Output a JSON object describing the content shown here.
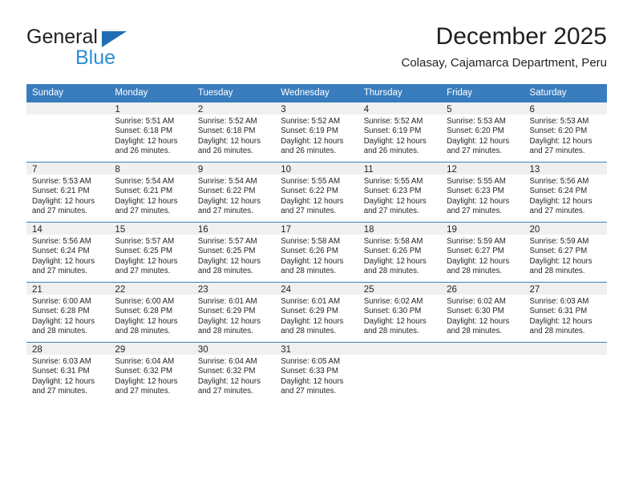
{
  "brand": {
    "name_top": "General",
    "name_bottom": "Blue",
    "triangle_color": "#1f6eb5",
    "blue_color": "#2a8fd4"
  },
  "header": {
    "title": "December 2025",
    "subtitle": "Colasay, Cajamarca Department, Peru"
  },
  "theme": {
    "header_bg": "#3a7dbe",
    "daynum_bg": "#f0f0f0",
    "text": "#231f20"
  },
  "weekdays": [
    "Sunday",
    "Monday",
    "Tuesday",
    "Wednesday",
    "Thursday",
    "Friday",
    "Saturday"
  ],
  "labels": {
    "sunrise_prefix": "Sunrise: ",
    "sunset_prefix": "Sunset: ",
    "daylight_prefix": "Daylight: "
  },
  "weeks": [
    [
      {
        "day": "",
        "empty": true
      },
      {
        "day": "1",
        "sunrise": "Sunrise: 5:51 AM",
        "sunset": "Sunset: 6:18 PM",
        "daylight_line1": "Daylight: 12 hours",
        "daylight_line2": "and 26 minutes."
      },
      {
        "day": "2",
        "sunrise": "Sunrise: 5:52 AM",
        "sunset": "Sunset: 6:18 PM",
        "daylight_line1": "Daylight: 12 hours",
        "daylight_line2": "and 26 minutes."
      },
      {
        "day": "3",
        "sunrise": "Sunrise: 5:52 AM",
        "sunset": "Sunset: 6:19 PM",
        "daylight_line1": "Daylight: 12 hours",
        "daylight_line2": "and 26 minutes."
      },
      {
        "day": "4",
        "sunrise": "Sunrise: 5:52 AM",
        "sunset": "Sunset: 6:19 PM",
        "daylight_line1": "Daylight: 12 hours",
        "daylight_line2": "and 26 minutes."
      },
      {
        "day": "5",
        "sunrise": "Sunrise: 5:53 AM",
        "sunset": "Sunset: 6:20 PM",
        "daylight_line1": "Daylight: 12 hours",
        "daylight_line2": "and 27 minutes."
      },
      {
        "day": "6",
        "sunrise": "Sunrise: 5:53 AM",
        "sunset": "Sunset: 6:20 PM",
        "daylight_line1": "Daylight: 12 hours",
        "daylight_line2": "and 27 minutes."
      }
    ],
    [
      {
        "day": "7",
        "sunrise": "Sunrise: 5:53 AM",
        "sunset": "Sunset: 6:21 PM",
        "daylight_line1": "Daylight: 12 hours",
        "daylight_line2": "and 27 minutes."
      },
      {
        "day": "8",
        "sunrise": "Sunrise: 5:54 AM",
        "sunset": "Sunset: 6:21 PM",
        "daylight_line1": "Daylight: 12 hours",
        "daylight_line2": "and 27 minutes."
      },
      {
        "day": "9",
        "sunrise": "Sunrise: 5:54 AM",
        "sunset": "Sunset: 6:22 PM",
        "daylight_line1": "Daylight: 12 hours",
        "daylight_line2": "and 27 minutes."
      },
      {
        "day": "10",
        "sunrise": "Sunrise: 5:55 AM",
        "sunset": "Sunset: 6:22 PM",
        "daylight_line1": "Daylight: 12 hours",
        "daylight_line2": "and 27 minutes."
      },
      {
        "day": "11",
        "sunrise": "Sunrise: 5:55 AM",
        "sunset": "Sunset: 6:23 PM",
        "daylight_line1": "Daylight: 12 hours",
        "daylight_line2": "and 27 minutes."
      },
      {
        "day": "12",
        "sunrise": "Sunrise: 5:55 AM",
        "sunset": "Sunset: 6:23 PM",
        "daylight_line1": "Daylight: 12 hours",
        "daylight_line2": "and 27 minutes."
      },
      {
        "day": "13",
        "sunrise": "Sunrise: 5:56 AM",
        "sunset": "Sunset: 6:24 PM",
        "daylight_line1": "Daylight: 12 hours",
        "daylight_line2": "and 27 minutes."
      }
    ],
    [
      {
        "day": "14",
        "sunrise": "Sunrise: 5:56 AM",
        "sunset": "Sunset: 6:24 PM",
        "daylight_line1": "Daylight: 12 hours",
        "daylight_line2": "and 27 minutes."
      },
      {
        "day": "15",
        "sunrise": "Sunrise: 5:57 AM",
        "sunset": "Sunset: 6:25 PM",
        "daylight_line1": "Daylight: 12 hours",
        "daylight_line2": "and 27 minutes."
      },
      {
        "day": "16",
        "sunrise": "Sunrise: 5:57 AM",
        "sunset": "Sunset: 6:25 PM",
        "daylight_line1": "Daylight: 12 hours",
        "daylight_line2": "and 28 minutes."
      },
      {
        "day": "17",
        "sunrise": "Sunrise: 5:58 AM",
        "sunset": "Sunset: 6:26 PM",
        "daylight_line1": "Daylight: 12 hours",
        "daylight_line2": "and 28 minutes."
      },
      {
        "day": "18",
        "sunrise": "Sunrise: 5:58 AM",
        "sunset": "Sunset: 6:26 PM",
        "daylight_line1": "Daylight: 12 hours",
        "daylight_line2": "and 28 minutes."
      },
      {
        "day": "19",
        "sunrise": "Sunrise: 5:59 AM",
        "sunset": "Sunset: 6:27 PM",
        "daylight_line1": "Daylight: 12 hours",
        "daylight_line2": "and 28 minutes."
      },
      {
        "day": "20",
        "sunrise": "Sunrise: 5:59 AM",
        "sunset": "Sunset: 6:27 PM",
        "daylight_line1": "Daylight: 12 hours",
        "daylight_line2": "and 28 minutes."
      }
    ],
    [
      {
        "day": "21",
        "sunrise": "Sunrise: 6:00 AM",
        "sunset": "Sunset: 6:28 PM",
        "daylight_line1": "Daylight: 12 hours",
        "daylight_line2": "and 28 minutes."
      },
      {
        "day": "22",
        "sunrise": "Sunrise: 6:00 AM",
        "sunset": "Sunset: 6:28 PM",
        "daylight_line1": "Daylight: 12 hours",
        "daylight_line2": "and 28 minutes."
      },
      {
        "day": "23",
        "sunrise": "Sunrise: 6:01 AM",
        "sunset": "Sunset: 6:29 PM",
        "daylight_line1": "Daylight: 12 hours",
        "daylight_line2": "and 28 minutes."
      },
      {
        "day": "24",
        "sunrise": "Sunrise: 6:01 AM",
        "sunset": "Sunset: 6:29 PM",
        "daylight_line1": "Daylight: 12 hours",
        "daylight_line2": "and 28 minutes."
      },
      {
        "day": "25",
        "sunrise": "Sunrise: 6:02 AM",
        "sunset": "Sunset: 6:30 PM",
        "daylight_line1": "Daylight: 12 hours",
        "daylight_line2": "and 28 minutes."
      },
      {
        "day": "26",
        "sunrise": "Sunrise: 6:02 AM",
        "sunset": "Sunset: 6:30 PM",
        "daylight_line1": "Daylight: 12 hours",
        "daylight_line2": "and 28 minutes."
      },
      {
        "day": "27",
        "sunrise": "Sunrise: 6:03 AM",
        "sunset": "Sunset: 6:31 PM",
        "daylight_line1": "Daylight: 12 hours",
        "daylight_line2": "and 28 minutes."
      }
    ],
    [
      {
        "day": "28",
        "sunrise": "Sunrise: 6:03 AM",
        "sunset": "Sunset: 6:31 PM",
        "daylight_line1": "Daylight: 12 hours",
        "daylight_line2": "and 27 minutes."
      },
      {
        "day": "29",
        "sunrise": "Sunrise: 6:04 AM",
        "sunset": "Sunset: 6:32 PM",
        "daylight_line1": "Daylight: 12 hours",
        "daylight_line2": "and 27 minutes."
      },
      {
        "day": "30",
        "sunrise": "Sunrise: 6:04 AM",
        "sunset": "Sunset: 6:32 PM",
        "daylight_line1": "Daylight: 12 hours",
        "daylight_line2": "and 27 minutes."
      },
      {
        "day": "31",
        "sunrise": "Sunrise: 6:05 AM",
        "sunset": "Sunset: 6:33 PM",
        "daylight_line1": "Daylight: 12 hours",
        "daylight_line2": "and 27 minutes."
      },
      {
        "day": "",
        "empty": true
      },
      {
        "day": "",
        "empty": true
      },
      {
        "day": "",
        "empty": true
      }
    ]
  ]
}
